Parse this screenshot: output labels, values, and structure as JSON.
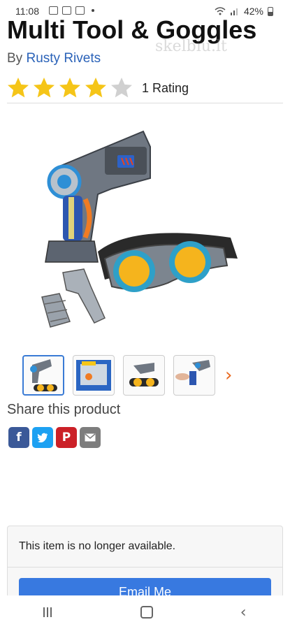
{
  "status_bar": {
    "time": "11:08",
    "battery": "42%"
  },
  "product": {
    "title": "Multi Tool & Goggles",
    "by_prefix": "By",
    "brand": "Rusty Rivets",
    "rating_value": 4,
    "rating_max": 5,
    "rating_text": "1 Rating"
  },
  "watermark": "skelbiu.lt",
  "thumbnails": [
    "Tool and goggles",
    "Packaged set",
    "Tool and goggles side",
    "Tool in hand"
  ],
  "share": {
    "title": "Share this product",
    "buttons": [
      "facebook",
      "twitter",
      "pinterest",
      "email"
    ]
  },
  "availability": {
    "message": "This item is no longer available.",
    "button_label": "Email Me"
  },
  "colors": {
    "star": "#f5c518",
    "star_empty": "#d0d0d0",
    "accent": "#3879e0"
  }
}
